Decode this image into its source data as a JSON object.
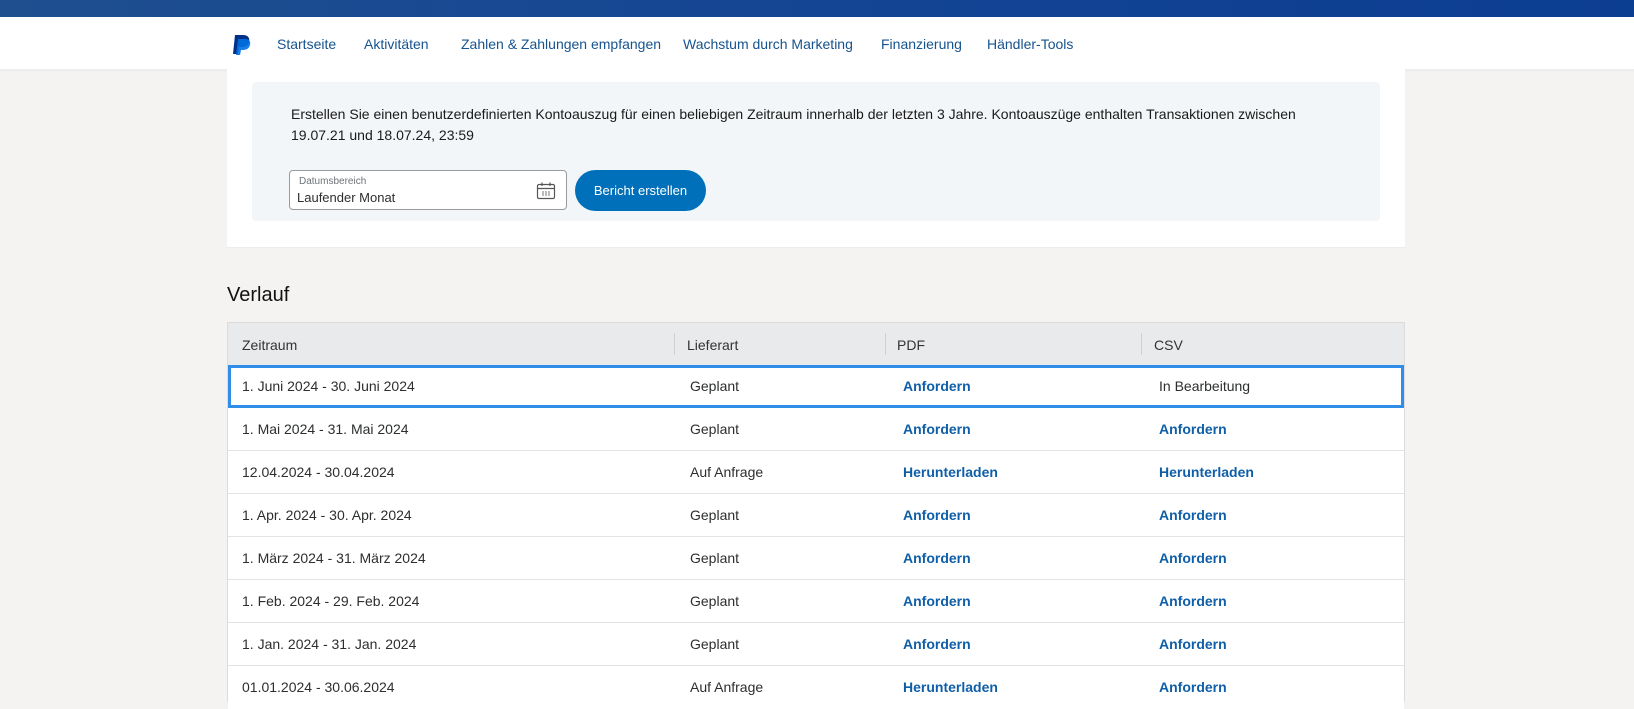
{
  "nav": {
    "logo": "paypal-logo",
    "items": [
      {
        "label": "Startseite"
      },
      {
        "label": "Aktivitäten"
      },
      {
        "label": "Zahlen & Zahlungen empfangen"
      },
      {
        "label": "Wachstum durch Marketing"
      },
      {
        "label": "Finanzierung"
      },
      {
        "label": "Händler-Tools"
      }
    ]
  },
  "statement": {
    "description": "Erstellen Sie einen benutzerdefinierten Kontoauszug für einen beliebigen Zeitraum innerhalb der letzten 3 Jahre. Kontoauszüge enthalten Transaktionen zwischen 19.07.21 und 18.07.24, 23:59",
    "date_range_label": "Datumsbereich",
    "date_range_value": "Laufender Monat",
    "calendar_icon": "calendar-icon",
    "create_button": "Bericht erstellen"
  },
  "history": {
    "title": "Verlauf",
    "columns": [
      "Zeitraum",
      "Lieferart",
      "PDF",
      "CSV"
    ],
    "rows": [
      {
        "period": "1. Juni 2024 - 30. Juni 2024",
        "delivery": "Geplant",
        "pdf": "Anfordern",
        "csv": "In Bearbeitung"
      },
      {
        "period": "1. Mai 2024 - 31. Mai 2024",
        "delivery": "Geplant",
        "pdf": "Anfordern",
        "csv": "Anfordern"
      },
      {
        "period": "12.04.2024 - 30.04.2024",
        "delivery": "Auf Anfrage",
        "pdf": "Herunterladen",
        "csv": "Herunterladen"
      },
      {
        "period": "1. Apr. 2024 - 30. Apr. 2024",
        "delivery": "Geplant",
        "pdf": "Anfordern",
        "csv": "Anfordern"
      },
      {
        "period": "1. März 2024 - 31. März 2024",
        "delivery": "Geplant",
        "pdf": "Anfordern",
        "csv": "Anfordern"
      },
      {
        "period": "1. Feb. 2024 - 29. Feb. 2024",
        "delivery": "Geplant",
        "pdf": "Anfordern",
        "csv": "Anfordern"
      },
      {
        "period": "1. Jan. 2024 - 31. Jan. 2024",
        "delivery": "Geplant",
        "pdf": "Anfordern",
        "csv": "Anfordern"
      },
      {
        "period": "01.01.2024 - 30.06.2024",
        "delivery": "Auf Anfrage",
        "pdf": "Herunterladen",
        "csv": "Anfordern"
      }
    ]
  },
  "colors": {
    "brand_blue": "#0070ba",
    "link_blue": "#0f5fa8",
    "nav_blue": "#16538f",
    "selection_outline": "#2f8fe8"
  }
}
